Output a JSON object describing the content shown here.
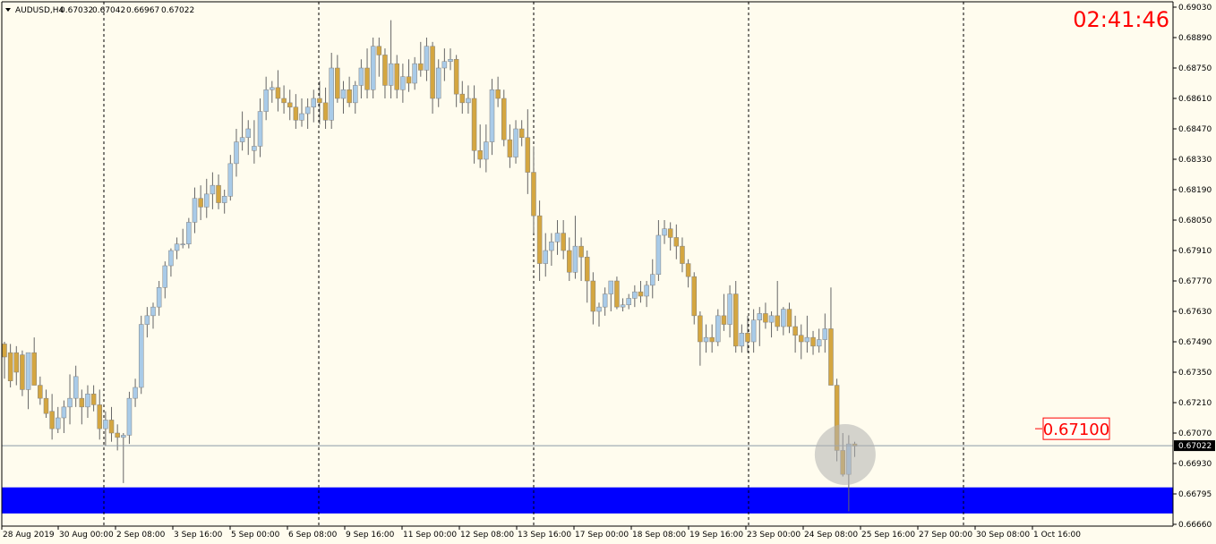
{
  "header": {
    "symbol": "AUDUSD,H4",
    "open": "0.67032",
    "high": "0.67042",
    "low": "0.66967",
    "close": "0.67022"
  },
  "clock": "02:41:46",
  "level_label": "0.67100",
  "current_price_label": "0.67022",
  "colors": {
    "background": "#fffcee",
    "bull_body": "#a9cbe8",
    "bear_body": "#d4a640",
    "wick": "#666666",
    "separator": "#000000",
    "current_line": "#8a9aa8",
    "zone": "#0000ff",
    "clock": "#ff0000"
  },
  "chart_data": {
    "type": "candlestick",
    "timeframe": "H4",
    "symbol": "AUDUSD",
    "ylim": [
      0.6666,
      0.6904
    ],
    "y_ticks": [
      "0.69030",
      "0.68890",
      "0.68750",
      "0.68610",
      "0.68470",
      "0.68330",
      "0.68190",
      "0.68050",
      "0.67910",
      "0.67770",
      "0.67630",
      "0.67490",
      "0.67350",
      "0.67210",
      "0.67070",
      "0.66930",
      "0.66795",
      "0.66660"
    ],
    "x_labels": [
      "28 Aug 2019",
      "30 Aug 00:00",
      "2 Sep 08:00",
      "3 Sep 16:00",
      "5 Sep 00:00",
      "6 Sep 08:00",
      "9 Sep 16:00",
      "11 Sep 00:00",
      "12 Sep 08:00",
      "13 Sep 16:00",
      "17 Sep 00:00",
      "18 Sep 08:00",
      "19 Sep 16:00",
      "23 Sep 00:00",
      "24 Sep 08:00",
      "25 Sep 16:00",
      "27 Sep 00:00",
      "30 Sep 08:00",
      "1 Oct 16:00"
    ],
    "current_price": 0.67022,
    "level_price": 0.671,
    "zone": [
      0.6671,
      0.6683
    ],
    "candles": [
      [
        0.6749,
        0.675,
        0.6733,
        0.6743
      ],
      [
        0.6745,
        0.6749,
        0.6729,
        0.6732
      ],
      [
        0.6745,
        0.6748,
        0.673,
        0.6736
      ],
      [
        0.6744,
        0.6746,
        0.6725,
        0.6728
      ],
      [
        0.6728,
        0.674,
        0.6719,
        0.6745
      ],
      [
        0.6745,
        0.6752,
        0.673,
        0.673
      ],
      [
        0.673,
        0.6734,
        0.6721,
        0.6724
      ],
      [
        0.6724,
        0.6728,
        0.6715,
        0.6717
      ],
      [
        0.6718,
        0.6726,
        0.6705,
        0.671
      ],
      [
        0.671,
        0.672,
        0.6708,
        0.6715
      ],
      [
        0.6715,
        0.6723,
        0.6708,
        0.672
      ],
      [
        0.672,
        0.6735,
        0.6712,
        0.6724
      ],
      [
        0.6724,
        0.6739,
        0.672,
        0.6734
      ],
      [
        0.6724,
        0.6728,
        0.6712,
        0.672
      ],
      [
        0.672,
        0.673,
        0.6715,
        0.6726
      ],
      [
        0.6726,
        0.673,
        0.6718,
        0.6721
      ],
      [
        0.6721,
        0.6728,
        0.6705,
        0.671
      ],
      [
        0.671,
        0.6718,
        0.6702,
        0.6714
      ],
      [
        0.6714,
        0.672,
        0.6704,
        0.6708
      ],
      [
        0.6708,
        0.6712,
        0.67,
        0.6706
      ],
      [
        0.6706,
        0.6708,
        0.6685,
        0.6707
      ],
      [
        0.6707,
        0.6727,
        0.6703,
        0.6724
      ],
      [
        0.6724,
        0.6733,
        0.672,
        0.6729
      ],
      [
        0.6729,
        0.6762,
        0.6726,
        0.6758
      ],
      [
        0.6758,
        0.6766,
        0.6752,
        0.6762
      ],
      [
        0.6762,
        0.6768,
        0.6756,
        0.6766
      ],
      [
        0.6766,
        0.6778,
        0.6762,
        0.6775
      ],
      [
        0.6775,
        0.6787,
        0.677,
        0.6785
      ],
      [
        0.6785,
        0.6793,
        0.678,
        0.6792
      ],
      [
        0.6792,
        0.6798,
        0.6788,
        0.6795
      ],
      [
        0.6795,
        0.6802,
        0.6793,
        0.6795
      ],
      [
        0.6795,
        0.6807,
        0.6793,
        0.6805
      ],
      [
        0.6805,
        0.6821,
        0.68,
        0.6816
      ],
      [
        0.6816,
        0.6822,
        0.6806,
        0.6812
      ],
      [
        0.6812,
        0.6825,
        0.6807,
        0.6818
      ],
      [
        0.6818,
        0.6828,
        0.6811,
        0.6822
      ],
      [
        0.6822,
        0.6827,
        0.6811,
        0.6814
      ],
      [
        0.6814,
        0.682,
        0.6809,
        0.6817
      ],
      [
        0.6817,
        0.6836,
        0.6815,
        0.6832
      ],
      [
        0.6832,
        0.6848,
        0.6826,
        0.6842
      ],
      [
        0.6842,
        0.6856,
        0.6838,
        0.6844
      ],
      [
        0.6844,
        0.6852,
        0.6836,
        0.6848
      ],
      [
        0.6838,
        0.6852,
        0.6832,
        0.684
      ],
      [
        0.684,
        0.6862,
        0.6835,
        0.6856
      ],
      [
        0.6856,
        0.6872,
        0.6852,
        0.6866
      ],
      [
        0.6866,
        0.687,
        0.686,
        0.6867
      ],
      [
        0.6867,
        0.6875,
        0.6856,
        0.6862
      ],
      [
        0.6862,
        0.6868,
        0.6855,
        0.686
      ],
      [
        0.686,
        0.6866,
        0.6852,
        0.6858
      ],
      [
        0.6858,
        0.6864,
        0.6848,
        0.6852
      ],
      [
        0.6852,
        0.6862,
        0.6849,
        0.6855
      ],
      [
        0.6855,
        0.6862,
        0.6848,
        0.6858
      ],
      [
        0.6858,
        0.6866,
        0.6851,
        0.6862
      ],
      [
        0.6862,
        0.687,
        0.685,
        0.686
      ],
      [
        0.686,
        0.6867,
        0.6848,
        0.6852
      ],
      [
        0.6852,
        0.6883,
        0.6848,
        0.6876
      ],
      [
        0.6876,
        0.6882,
        0.686,
        0.6862
      ],
      [
        0.6862,
        0.687,
        0.6855,
        0.6866
      ],
      [
        0.6866,
        0.6872,
        0.6858,
        0.686
      ],
      [
        0.686,
        0.687,
        0.6855,
        0.6868
      ],
      [
        0.6868,
        0.688,
        0.6862,
        0.6876
      ],
      [
        0.6876,
        0.6885,
        0.6862,
        0.6866
      ],
      [
        0.6866,
        0.689,
        0.6862,
        0.6886
      ],
      [
        0.6886,
        0.689,
        0.6872,
        0.6882
      ],
      [
        0.6882,
        0.6885,
        0.6862,
        0.6868
      ],
      [
        0.6868,
        0.6898,
        0.6862,
        0.6878
      ],
      [
        0.6878,
        0.6882,
        0.6862,
        0.6866
      ],
      [
        0.6866,
        0.6878,
        0.686,
        0.6872
      ],
      [
        0.6872,
        0.688,
        0.6865,
        0.6869
      ],
      [
        0.6869,
        0.6881,
        0.6866,
        0.6878
      ],
      [
        0.6878,
        0.6888,
        0.6872,
        0.6875
      ],
      [
        0.6875,
        0.689,
        0.687,
        0.6886
      ],
      [
        0.6886,
        0.6888,
        0.6855,
        0.6862
      ],
      [
        0.6862,
        0.688,
        0.6858,
        0.6876
      ],
      [
        0.6876,
        0.6885,
        0.687,
        0.6879
      ],
      [
        0.6879,
        0.6885,
        0.6875,
        0.688
      ],
      [
        0.688,
        0.6882,
        0.6858,
        0.6864
      ],
      [
        0.6864,
        0.687,
        0.6855,
        0.686
      ],
      [
        0.686,
        0.6868,
        0.6855,
        0.6862
      ],
      [
        0.6862,
        0.6868,
        0.6832,
        0.6838
      ],
      [
        0.6838,
        0.685,
        0.683,
        0.6834
      ],
      [
        0.6834,
        0.685,
        0.6828,
        0.6842
      ],
      [
        0.6842,
        0.6871,
        0.6836,
        0.6866
      ],
      [
        0.6866,
        0.6872,
        0.6858,
        0.6862
      ],
      [
        0.6862,
        0.6866,
        0.684,
        0.6843
      ],
      [
        0.6843,
        0.685,
        0.683,
        0.6835
      ],
      [
        0.6835,
        0.6852,
        0.6832,
        0.6848
      ],
      [
        0.6848,
        0.6852,
        0.684,
        0.6844
      ],
      [
        0.6844,
        0.6857,
        0.6818,
        0.6828
      ],
      [
        0.6828,
        0.684,
        0.68,
        0.6808
      ],
      [
        0.6808,
        0.6815,
        0.6778,
        0.6786
      ],
      [
        0.6786,
        0.68,
        0.678,
        0.6792
      ],
      [
        0.6792,
        0.68,
        0.6785,
        0.6796
      ],
      [
        0.6796,
        0.6806,
        0.679,
        0.68
      ],
      [
        0.68,
        0.6806,
        0.6788,
        0.6792
      ],
      [
        0.6792,
        0.6798,
        0.6778,
        0.6782
      ],
      [
        0.6782,
        0.6808,
        0.6779,
        0.6794
      ],
      [
        0.6794,
        0.6798,
        0.6778,
        0.6789
      ],
      [
        0.6789,
        0.6792,
        0.6768,
        0.6778
      ],
      [
        0.6778,
        0.6782,
        0.6758,
        0.6764
      ],
      [
        0.6764,
        0.6768,
        0.6757,
        0.6766
      ],
      [
        0.6766,
        0.6775,
        0.6762,
        0.6772
      ],
      [
        0.6772,
        0.6778,
        0.6764,
        0.6778
      ],
      [
        0.6778,
        0.678,
        0.6765,
        0.6766
      ],
      [
        0.6766,
        0.677,
        0.6764,
        0.6767
      ],
      [
        0.6767,
        0.6772,
        0.6765,
        0.677
      ],
      [
        0.677,
        0.6776,
        0.6766,
        0.6773
      ],
      [
        0.6773,
        0.6778,
        0.6768,
        0.6771
      ],
      [
        0.6771,
        0.6778,
        0.6766,
        0.6776
      ],
      [
        0.6776,
        0.6788,
        0.677,
        0.6781
      ],
      [
        0.6781,
        0.6806,
        0.6778,
        0.6799
      ],
      [
        0.6799,
        0.6806,
        0.6795,
        0.6802
      ],
      [
        0.6802,
        0.6805,
        0.6792,
        0.6798
      ],
      [
        0.6798,
        0.6804,
        0.6788,
        0.6794
      ],
      [
        0.6794,
        0.6798,
        0.6782,
        0.6786
      ],
      [
        0.6786,
        0.6788,
        0.6775,
        0.678
      ],
      [
        0.678,
        0.6782,
        0.6758,
        0.6762
      ],
      [
        0.6762,
        0.6764,
        0.6739,
        0.675
      ],
      [
        0.675,
        0.6758,
        0.6745,
        0.6752
      ],
      [
        0.6752,
        0.6758,
        0.6745,
        0.675
      ],
      [
        0.675,
        0.6765,
        0.6748,
        0.6762
      ],
      [
        0.6762,
        0.6772,
        0.6755,
        0.6758
      ],
      [
        0.6758,
        0.6776,
        0.6752,
        0.6772
      ],
      [
        0.6772,
        0.6778,
        0.6745,
        0.6748
      ],
      [
        0.6748,
        0.6758,
        0.6745,
        0.6754
      ],
      [
        0.6754,
        0.6762,
        0.6745,
        0.675
      ],
      [
        0.675,
        0.6765,
        0.6745,
        0.676
      ],
      [
        0.676,
        0.6766,
        0.6748,
        0.6763
      ],
      [
        0.6763,
        0.6768,
        0.6756,
        0.6759
      ],
      [
        0.6759,
        0.6764,
        0.6752,
        0.6762
      ],
      [
        0.6762,
        0.6778,
        0.6755,
        0.6757
      ],
      [
        0.6757,
        0.6766,
        0.6753,
        0.6765
      ],
      [
        0.6765,
        0.6768,
        0.6754,
        0.6757
      ],
      [
        0.6757,
        0.6762,
        0.6745,
        0.6753
      ],
      [
        0.6753,
        0.6758,
        0.6742,
        0.675
      ],
      [
        0.675,
        0.6762,
        0.6745,
        0.6752
      ],
      [
        0.6752,
        0.6755,
        0.6744,
        0.6748
      ],
      [
        0.6748,
        0.6756,
        0.6745,
        0.6751
      ],
      [
        0.6751,
        0.6763,
        0.6745,
        0.6756
      ],
      [
        0.6756,
        0.6775,
        0.6738,
        0.673
      ],
      [
        0.673,
        0.6733,
        0.6695,
        0.67
      ],
      [
        0.67,
        0.6708,
        0.6688,
        0.6689
      ],
      [
        0.6689,
        0.6707,
        0.6672,
        0.6703
      ],
      [
        0.6703,
        0.6704,
        0.6697,
        0.6702
      ]
    ]
  }
}
